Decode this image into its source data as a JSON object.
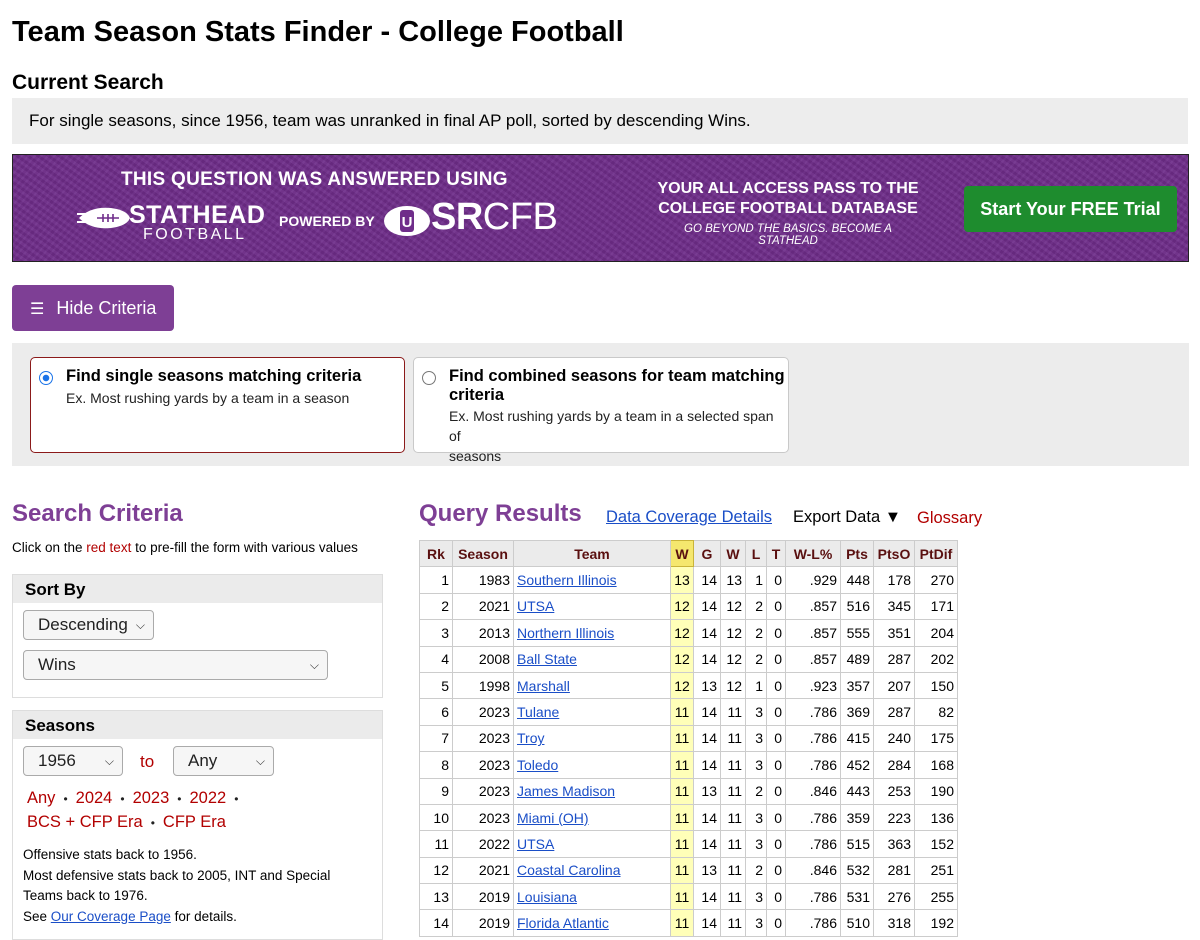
{
  "page": {
    "title": "Team Season Stats Finder - College Football",
    "current_search_heading": "Current Search",
    "current_search_text": "For single seasons, since 1956, team was unranked in final AP poll, sorted by descending Wins."
  },
  "promo": {
    "answered": "THIS QUESTION WAS ANSWERED USING",
    "stathead": "STATHEAD",
    "football": "FOOTBALL",
    "powered_by": "POWERED BY",
    "sr": "SR",
    "cfb": "CFB",
    "pass_text": "YOUR ALL ACCESS PASS TO THE COLLEGE FOOTBALL DATABASE",
    "tagline": "GO BEYOND THE BASICS. BECOME A STATHEAD",
    "trial_button": "Start Your FREE Trial",
    "colors": {
      "background": "#6f2d8a",
      "button": "#1e8c2e"
    }
  },
  "hide_criteria": {
    "label": "Hide Criteria",
    "icon": "menu-icon"
  },
  "modes": {
    "single": {
      "title": "Find single seasons matching criteria",
      "example": "Ex. Most rushing yards by a team in a season",
      "selected": true
    },
    "combined": {
      "title_line1": "Find combined seasons for team matching",
      "title_line2": "criteria",
      "example_line1": "Ex. Most rushing yards by a team in a selected span of",
      "example_line2": "seasons",
      "selected": false
    }
  },
  "search_criteria": {
    "title": "Search Criteria",
    "hint_prefix": "Click on the ",
    "hint_red": "red text",
    "hint_suffix": " to pre-fill the form with various values",
    "sort_by": {
      "heading": "Sort By",
      "order": "Descending",
      "stat": "Wins"
    },
    "seasons": {
      "heading": "Seasons",
      "from": "1956",
      "to_label": "to",
      "to": "Any",
      "quick_links": [
        "Any",
        "2024",
        "2023",
        "2022",
        "BCS + CFP Era",
        "CFP Era"
      ]
    },
    "notes": {
      "line1": "Offensive stats back to 1956.",
      "line2": "Most defensive stats back to 2005, INT and Special Teams back to 1976.",
      "see": "See ",
      "link": "Our Coverage Page",
      "after": " for details."
    }
  },
  "results": {
    "title": "Query Results",
    "coverage_link": "Data Coverage Details",
    "export": "Export Data ▼",
    "glossary": "Glossary",
    "columns": [
      "Rk",
      "Season",
      "Team",
      "W",
      "G",
      "W",
      "L",
      "T",
      "W-L%",
      "Pts",
      "PtsO",
      "PtDif"
    ],
    "sorted_column": "W",
    "sort_highlight_color": "#ffffb8",
    "rows": [
      [
        "1",
        "1983",
        "Southern Illinois",
        "13",
        "14",
        "13",
        "1",
        "0",
        ".929",
        "448",
        "178",
        "270"
      ],
      [
        "2",
        "2021",
        "UTSA",
        "12",
        "14",
        "12",
        "2",
        "0",
        ".857",
        "516",
        "345",
        "171"
      ],
      [
        "3",
        "2013",
        "Northern Illinois",
        "12",
        "14",
        "12",
        "2",
        "0",
        ".857",
        "555",
        "351",
        "204"
      ],
      [
        "4",
        "2008",
        "Ball State",
        "12",
        "14",
        "12",
        "2",
        "0",
        ".857",
        "489",
        "287",
        "202"
      ],
      [
        "5",
        "1998",
        "Marshall",
        "12",
        "13",
        "12",
        "1",
        "0",
        ".923",
        "357",
        "207",
        "150"
      ],
      [
        "6",
        "2023",
        "Tulane",
        "11",
        "14",
        "11",
        "3",
        "0",
        ".786",
        "369",
        "287",
        "82"
      ],
      [
        "7",
        "2023",
        "Troy",
        "11",
        "14",
        "11",
        "3",
        "0",
        ".786",
        "415",
        "240",
        "175"
      ],
      [
        "8",
        "2023",
        "Toledo",
        "11",
        "14",
        "11",
        "3",
        "0",
        ".786",
        "452",
        "284",
        "168"
      ],
      [
        "9",
        "2023",
        "James Madison",
        "11",
        "13",
        "11",
        "2",
        "0",
        ".846",
        "443",
        "253",
        "190"
      ],
      [
        "10",
        "2023",
        "Miami (OH)",
        "11",
        "14",
        "11",
        "3",
        "0",
        ".786",
        "359",
        "223",
        "136"
      ],
      [
        "11",
        "2022",
        "UTSA",
        "11",
        "14",
        "11",
        "3",
        "0",
        ".786",
        "515",
        "363",
        "152"
      ],
      [
        "12",
        "2021",
        "Coastal Carolina",
        "11",
        "13",
        "11",
        "2",
        "0",
        ".846",
        "532",
        "281",
        "251"
      ],
      [
        "13",
        "2019",
        "Louisiana",
        "11",
        "14",
        "11",
        "3",
        "0",
        ".786",
        "531",
        "276",
        "255"
      ],
      [
        "14",
        "2019",
        "Florida Atlantic",
        "11",
        "14",
        "11",
        "3",
        "0",
        ".786",
        "510",
        "318",
        "192"
      ]
    ]
  }
}
